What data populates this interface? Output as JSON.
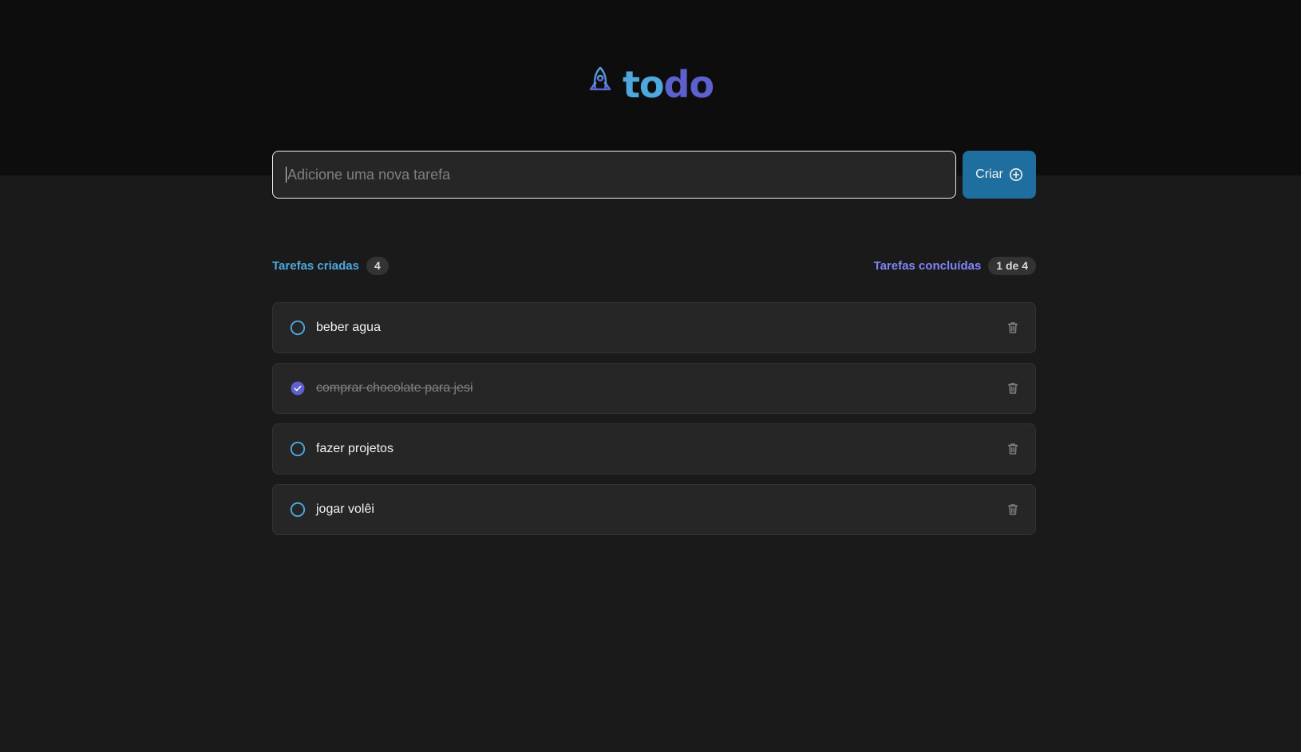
{
  "app": {
    "logo_to": "to",
    "logo_do": "do"
  },
  "new_task": {
    "placeholder": "Adicione uma nova tarefa",
    "value": "",
    "button_label": "Criar"
  },
  "stats": {
    "created_label": "Tarefas criadas",
    "created_count": "4",
    "done_label": "Tarefas concluídas",
    "done_count": "1 de 4"
  },
  "tasks": [
    {
      "text": "beber agua",
      "done": false
    },
    {
      "text": "comprar chocolate para jesi",
      "done": true
    },
    {
      "text": "fazer projetos",
      "done": false
    },
    {
      "text": "jogar volêi",
      "done": false
    }
  ],
  "icons": {
    "logo": "rocket-icon",
    "create": "plus-circle-icon",
    "unchecked": "circle-icon",
    "checked": "check-circle-icon",
    "delete": "trash-icon"
  },
  "colors": {
    "blue": "#4ea8de",
    "purple": "#5e60ce",
    "purple_light": "#8284fa",
    "button": "#1e6f9f",
    "header_bg": "#0d0d0d",
    "page_bg": "#1a1a1a"
  }
}
